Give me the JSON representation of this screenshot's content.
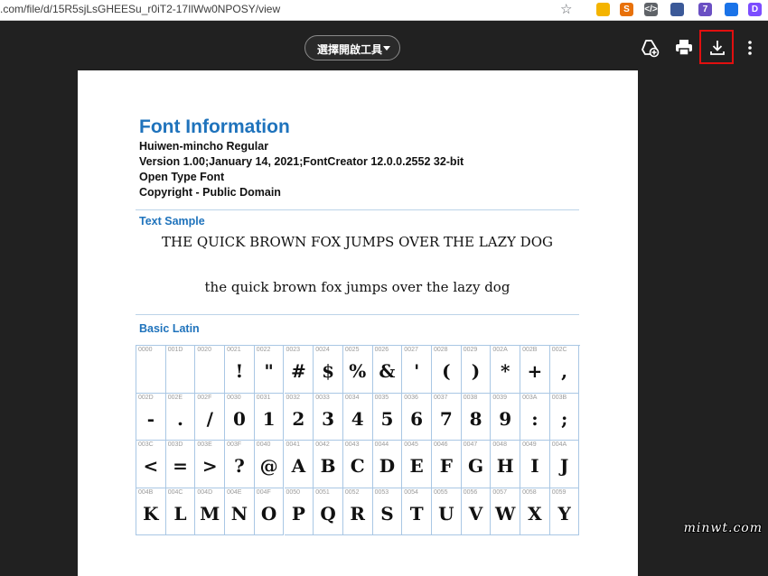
{
  "browser": {
    "url": ".com/file/d/15R5sjLsGHEESu_r0iT2-17IlWw0NPOSY/view",
    "extensions": [
      {
        "name": "google-keep-icon",
        "color": "#f4b400",
        "label": ""
      },
      {
        "name": "sync-icon",
        "color": "#e8710a",
        "label": "S"
      },
      {
        "name": "code-icon",
        "color": "#5f6368",
        "label": "</>"
      },
      {
        "name": "feather-icon",
        "color": "#3b5998",
        "label": ""
      },
      {
        "name": "badge-icon",
        "color": "#6a4fc3",
        "label": "7"
      },
      {
        "name": "rocket-icon",
        "color": "#1a73e8",
        "label": ""
      },
      {
        "name": "d-icon",
        "color": "#7c4dff",
        "label": "D"
      }
    ]
  },
  "toolbar": {
    "open_with_label": "選擇開啟工具"
  },
  "document": {
    "title": "Font Information",
    "font_name": "Huiwen-mincho Regular",
    "version": "Version 1.00;January 14, 2021;FontCreator 12.0.0.2552 32-bit",
    "type": "Open Type Font",
    "copyright": "Copyright - Public Domain",
    "text_sample_heading": "Text Sample",
    "sample_upper": "THE QUICK BROWN FOX JUMPS OVER THE LAZY DOG",
    "sample_lower": "the quick brown fox jumps over the lazy dog",
    "basic_latin_heading": "Basic Latin",
    "grid": [
      [
        [
          "0000",
          ""
        ],
        [
          "001D",
          ""
        ],
        [
          "0020",
          ""
        ],
        [
          "0021",
          "!"
        ],
        [
          "0022",
          "\""
        ],
        [
          "0023",
          "#"
        ],
        [
          "0024",
          "$"
        ],
        [
          "0025",
          "%"
        ],
        [
          "0026",
          "&"
        ],
        [
          "0027",
          "'"
        ],
        [
          "0028",
          "("
        ],
        [
          "0029",
          ")"
        ],
        [
          "002A",
          "*"
        ],
        [
          "002B",
          "+"
        ],
        [
          "002C",
          ","
        ]
      ],
      [
        [
          "002D",
          "-"
        ],
        [
          "002E",
          "."
        ],
        [
          "002F",
          "/"
        ],
        [
          "0030",
          "0"
        ],
        [
          "0031",
          "1"
        ],
        [
          "0032",
          "2"
        ],
        [
          "0033",
          "3"
        ],
        [
          "0034",
          "4"
        ],
        [
          "0035",
          "5"
        ],
        [
          "0036",
          "6"
        ],
        [
          "0037",
          "7"
        ],
        [
          "0038",
          "8"
        ],
        [
          "0039",
          "9"
        ],
        [
          "003A",
          ":"
        ],
        [
          "003B",
          ";"
        ]
      ],
      [
        [
          "003C",
          "<"
        ],
        [
          "003D",
          "="
        ],
        [
          "003E",
          ">"
        ],
        [
          "003F",
          "?"
        ],
        [
          "0040",
          "@"
        ],
        [
          "0041",
          "A"
        ],
        [
          "0042",
          "B"
        ],
        [
          "0043",
          "C"
        ],
        [
          "0044",
          "D"
        ],
        [
          "0045",
          "E"
        ],
        [
          "0046",
          "F"
        ],
        [
          "0047",
          "G"
        ],
        [
          "0048",
          "H"
        ],
        [
          "0049",
          "I"
        ],
        [
          "004A",
          "J"
        ]
      ],
      [
        [
          "004B",
          "K"
        ],
        [
          "004C",
          "L"
        ],
        [
          "004D",
          "M"
        ],
        [
          "004E",
          "N"
        ],
        [
          "004F",
          "O"
        ],
        [
          "0050",
          "P"
        ],
        [
          "0051",
          "Q"
        ],
        [
          "0052",
          "R"
        ],
        [
          "0053",
          "S"
        ],
        [
          "0054",
          "T"
        ],
        [
          "0055",
          "U"
        ],
        [
          "0056",
          "V"
        ],
        [
          "0057",
          "W"
        ],
        [
          "0058",
          "X"
        ],
        [
          "0059",
          "Y"
        ]
      ]
    ]
  },
  "watermark": "minwt.com"
}
